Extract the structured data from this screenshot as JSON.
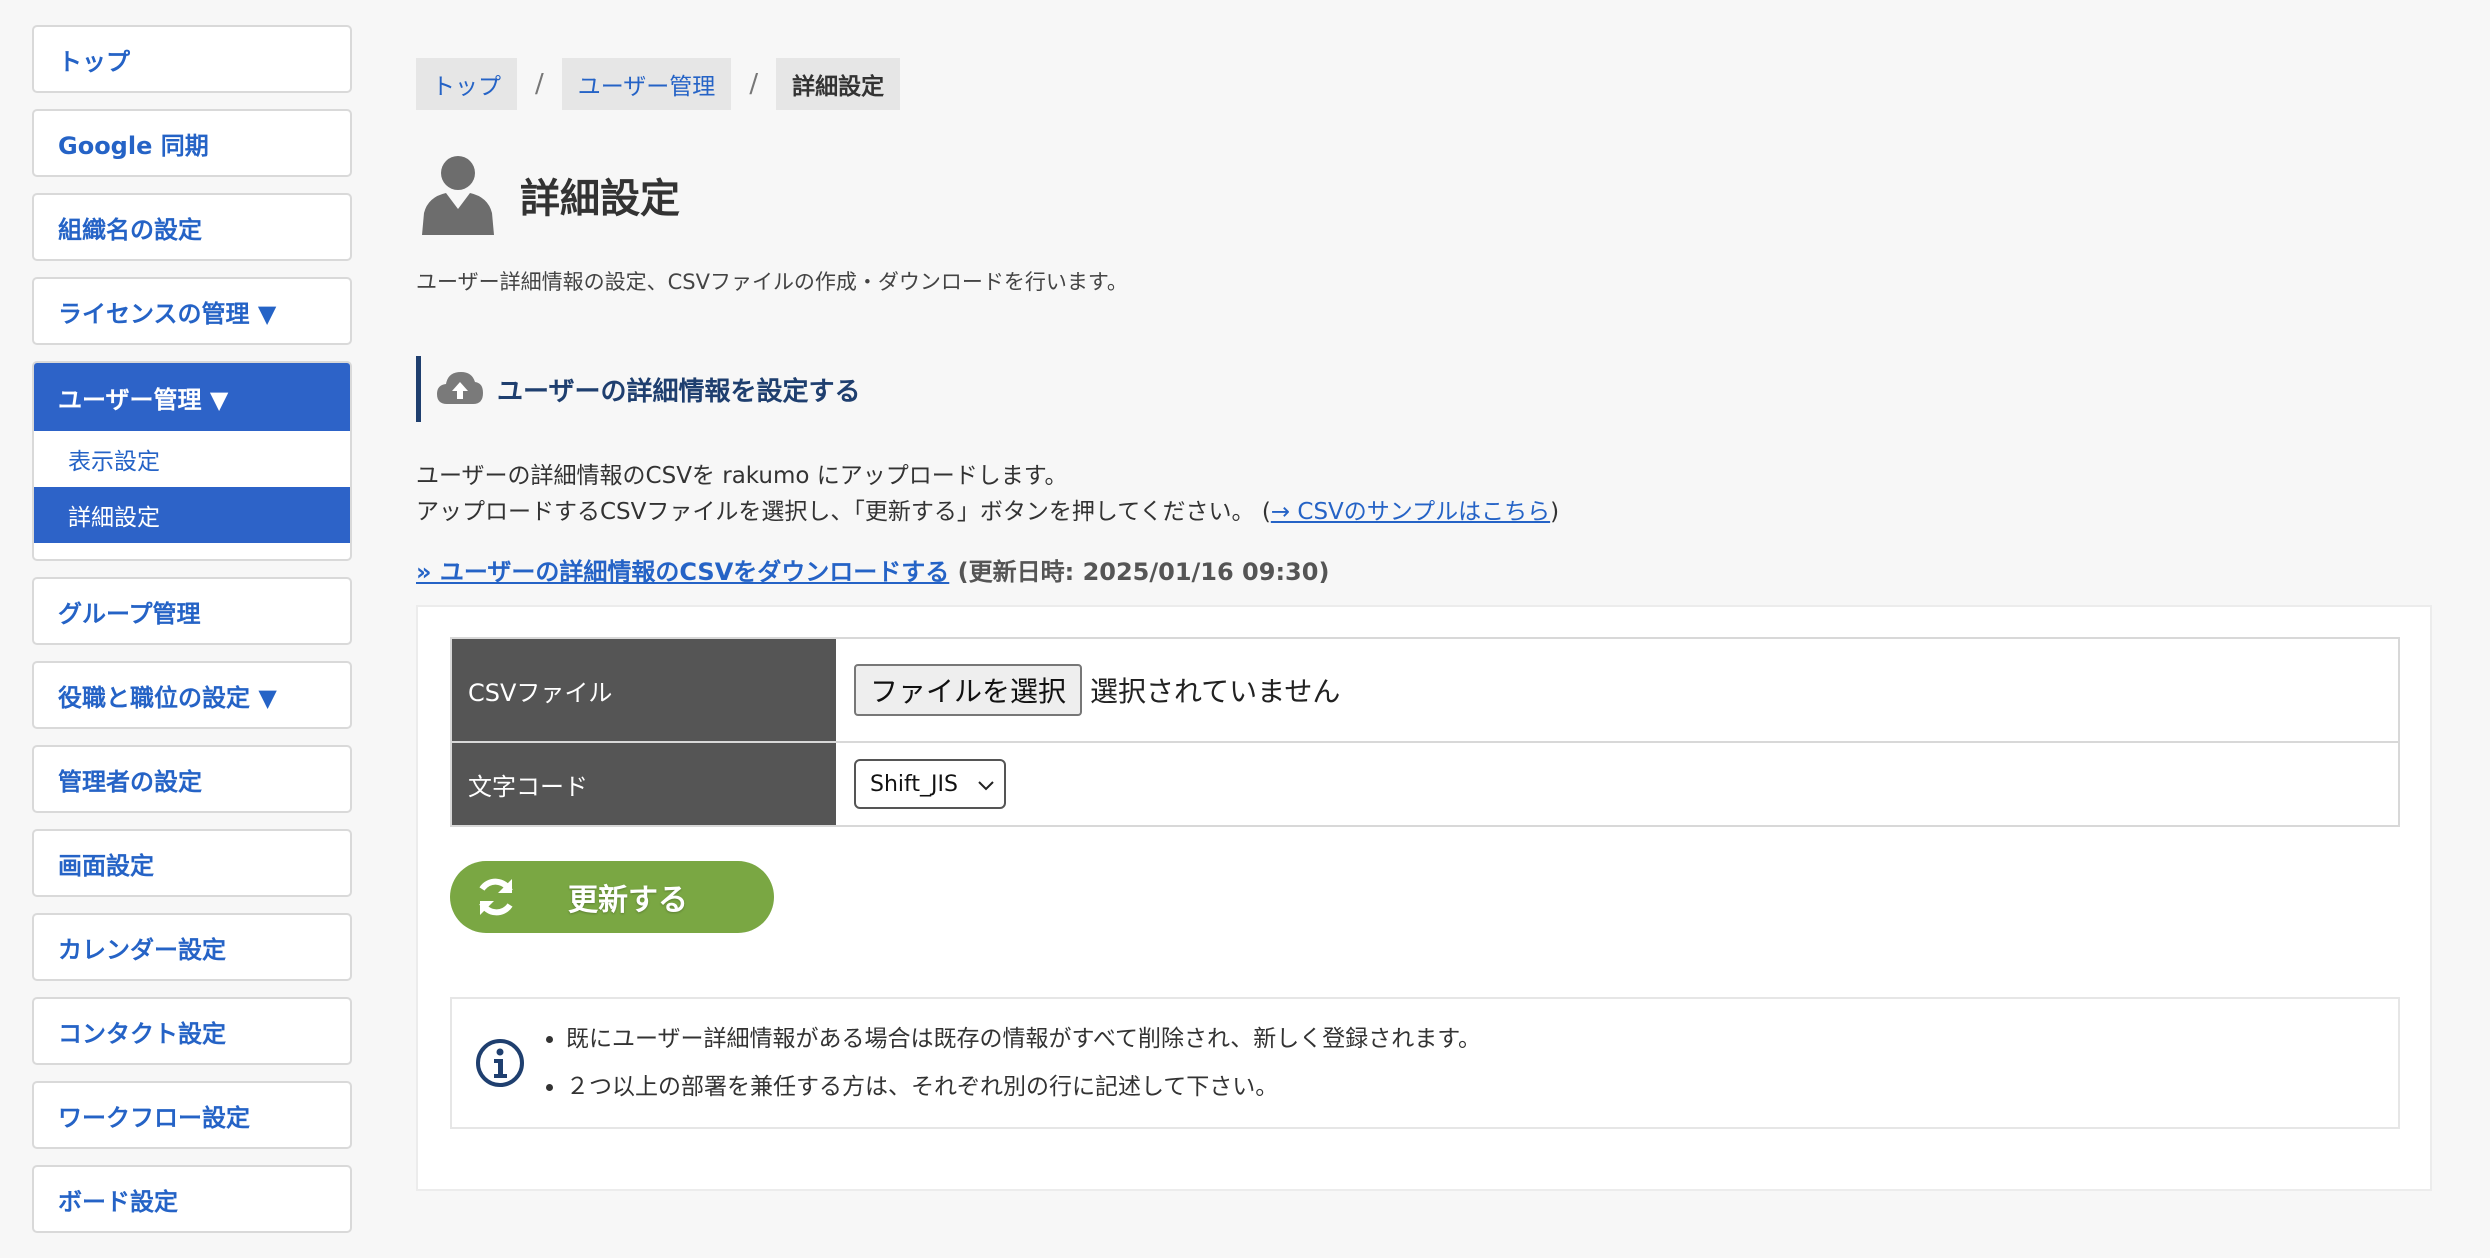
{
  "sidebar": {
    "items": [
      {
        "label": "トップ"
      },
      {
        "label": "Google 同期"
      },
      {
        "label": "組織名の設定"
      },
      {
        "label": "ライセンスの管理 ▼"
      },
      {
        "label": "ユーザー管理 ▼",
        "subitems": [
          {
            "label": "表示設定"
          },
          {
            "label": "詳細設定"
          }
        ]
      },
      {
        "label": "グループ管理"
      },
      {
        "label": "役職と職位の設定 ▼"
      },
      {
        "label": "管理者の設定"
      },
      {
        "label": "画面設定"
      },
      {
        "label": "カレンダー設定"
      },
      {
        "label": "コンタクト設定"
      },
      {
        "label": "ワークフロー設定"
      },
      {
        "label": "ボード設定"
      }
    ]
  },
  "breadcrumb": [
    "トップ",
    "ユーザー管理",
    "詳細設定"
  ],
  "breadcrumb_sep": "/",
  "page": {
    "title": "詳細設定",
    "description": "ユーザー詳細情報の設定、CSVファイルの作成・ダウンロードを行います。"
  },
  "section": {
    "title": "ユーザーの詳細情報を設定する",
    "line1": "ユーザーの詳細情報のCSVを rakumo にアップロードします。",
    "line2": "アップロードするCSVファイルを選択し、「更新する」ボタンを押してください。",
    "sample_open": "(",
    "sample_link": "→ CSVのサンプルはこちら",
    "sample_close": ")",
    "download_link": "» ユーザーの詳細情報のCSVをダウンロードする",
    "download_meta": "(更新日時: 2025/01/16 09:30)"
  },
  "form": {
    "csv_label": "CSVファイル",
    "file_button": "ファイルを選択",
    "file_status": "選択されていません",
    "encoding_label": "文字コード",
    "encoding_value": "Shift_JIS"
  },
  "update_button": "更新する",
  "notes": [
    "既にユーザー詳細情報がある場合は既存の情報がすべて削除され、新しく登録されます。",
    "２つ以上の部署を兼任する方は、それぞれ別の行に記述して下さい。"
  ],
  "colors": {
    "accent": "#2d63c8",
    "link": "#2563c6",
    "button_green": "#7aa743",
    "section_dark": "#1f3f6f",
    "label_bg": "#555555"
  }
}
